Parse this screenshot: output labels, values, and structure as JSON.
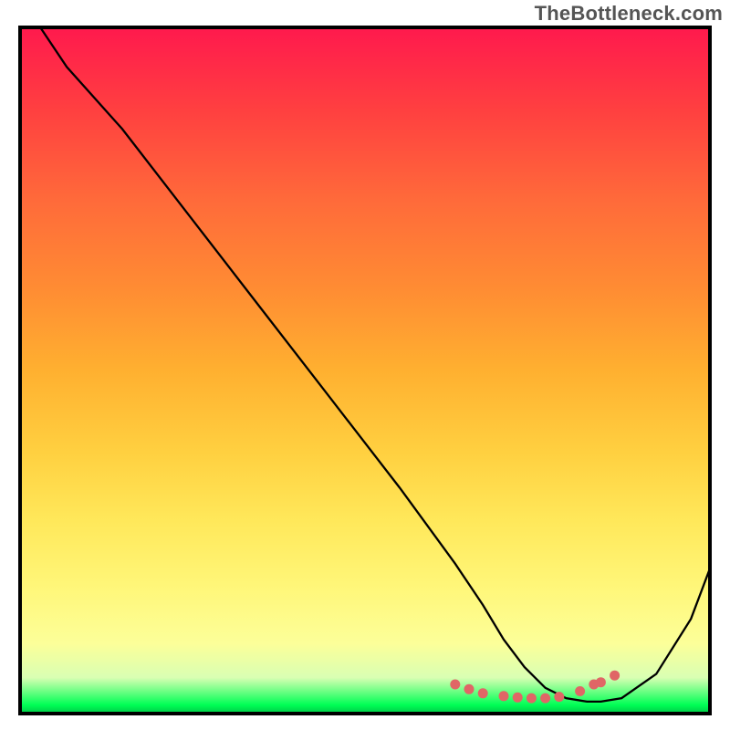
{
  "watermark": "TheBottleneck.com",
  "chart_data": {
    "type": "line",
    "title": "",
    "xlabel": "",
    "ylabel": "",
    "xlim": [
      0,
      100
    ],
    "ylim": [
      0,
      100
    ],
    "series": [
      {
        "name": "curve",
        "x": [
          3,
          7,
          15,
          25,
          35,
          45,
          55,
          63,
          67,
          70,
          73,
          76,
          79,
          82,
          84,
          87,
          92,
          97,
          100
        ],
        "y": [
          100,
          94,
          85,
          72,
          59,
          46,
          33,
          22,
          16,
          11,
          7,
          4,
          2.5,
          2,
          2,
          2.5,
          6,
          14,
          22
        ]
      }
    ],
    "markers": {
      "name": "dots",
      "x": [
        63,
        65,
        67,
        70,
        72,
        74,
        76,
        78,
        81,
        83,
        84,
        86
      ],
      "y": [
        4.5,
        3.8,
        3.2,
        2.8,
        2.6,
        2.5,
        2.5,
        2.7,
        3.5,
        4.5,
        4.8,
        5.8
      ]
    },
    "gradient_stops": [
      {
        "pos": 0,
        "color": "#ff1a4d"
      },
      {
        "pos": 25,
        "color": "#ff6a3a"
      },
      {
        "pos": 50,
        "color": "#ffb030"
      },
      {
        "pos": 75,
        "color": "#ffe85a"
      },
      {
        "pos": 95,
        "color": "#d9ffb3"
      },
      {
        "pos": 100,
        "color": "#00d44a"
      }
    ]
  }
}
